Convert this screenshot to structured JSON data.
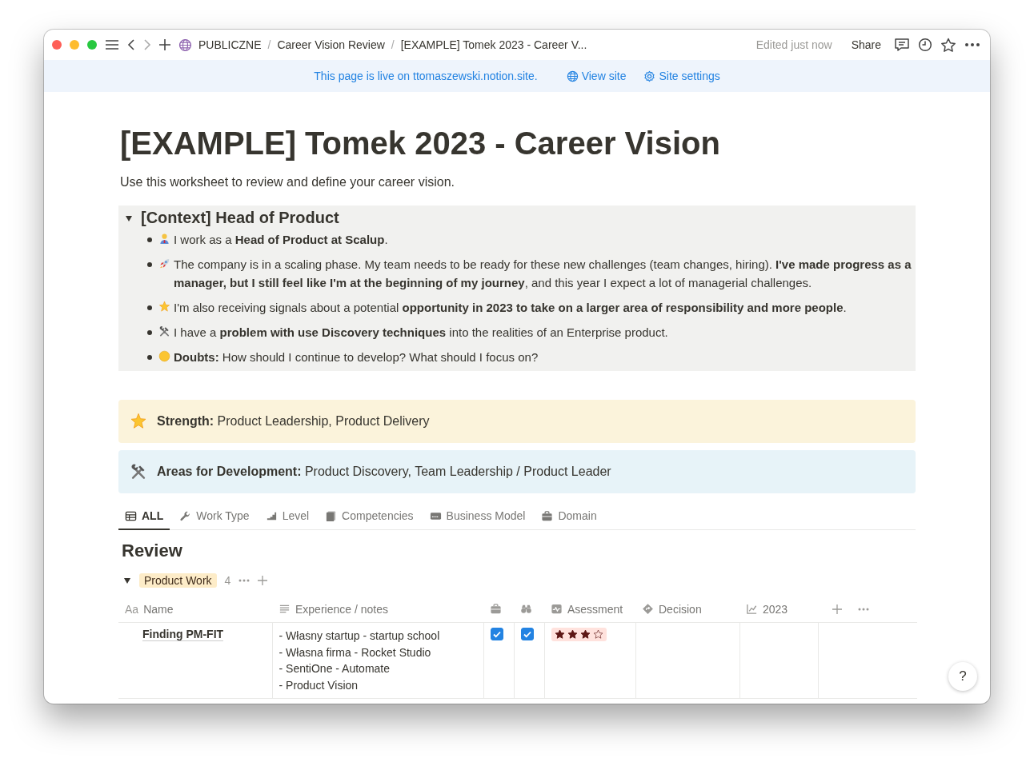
{
  "window": {
    "breadcrumbs": [
      "PUBLICZNE",
      "Career Vision Review",
      "[EXAMPLE] Tomek 2023 - Career V..."
    ],
    "breadcrumb_separator": "/",
    "edited": "Edited just now",
    "share": "Share"
  },
  "banner": {
    "text": "This page is live on ttomaszewski.notion.site.",
    "links": [
      {
        "kind": "globe",
        "label": "View site"
      },
      {
        "kind": "gear",
        "label": "Site settings"
      }
    ]
  },
  "page": {
    "title": "[EXAMPLE] Tomek 2023 - Career Vision",
    "description": "Use this worksheet to review and define your career vision.",
    "toggle": {
      "title": "[Context] Head of Product",
      "expanded": true,
      "items": [
        {
          "kind": "person",
          "text": "I work as a **Head of Product at Scalup**."
        },
        {
          "kind": "rocket",
          "text": "The company is in a scaling phase. My team needs to be ready for these new challenges (team changes, hiring). **I've made progress as a manager, but I still feel like I'm at the beginning of my journey**, and this year I expect a lot of managerial challenges."
        },
        {
          "kind": "sparkle",
          "text": "I'm also receiving signals about a potential **opportunity in 2023 to take on a larger area of responsibility and more people**."
        },
        {
          "kind": "tools",
          "text": "I have a **problem with use Discovery techniques** into the realities of an Enterprise product."
        },
        {
          "kind": "emoji",
          "text": "**Doubts:** How should I continue to develop? What should I focus on?"
        }
      ]
    },
    "callouts": [
      {
        "kind": "sparkle",
        "color": "#fbf3db",
        "text": "**Strength:** Product Leadership, Product Delivery"
      },
      {
        "kind": "tools",
        "color": "#e7f3f8",
        "text": "**Areas for Development:** Product Discovery, Team Leadership / Product Leader"
      }
    ],
    "tabs": [
      {
        "kind": "table",
        "label": "ALL",
        "selected": true
      },
      {
        "kind": "wrench",
        "label": "Work Type",
        "selected": false
      },
      {
        "kind": "bars",
        "label": "Level",
        "selected": false
      },
      {
        "kind": "pages",
        "label": "Competencies",
        "selected": false
      },
      {
        "kind": "card",
        "label": "Business Model",
        "selected": false
      },
      {
        "kind": "briefcase",
        "label": "Domain",
        "selected": false
      }
    ],
    "section_title": "Review",
    "group": {
      "label": "Product Work",
      "count": "4",
      "expanded": true
    },
    "table": {
      "columns": [
        {
          "prefix": "Aa",
          "label": "Name"
        },
        {
          "kind": "lines",
          "label": "Experience / notes"
        },
        {
          "kind": "briefcase"
        },
        {
          "kind": "binoculars"
        },
        {
          "kind": "pulse",
          "label": "Asessment"
        },
        {
          "kind": "diamond",
          "label": "Decision"
        },
        {
          "kind": "chart",
          "label": "2023"
        }
      ],
      "rows": [
        {
          "name": "Finding PM-FIT",
          "notes": [
            "- Własny startup - startup school",
            "- Własna firma - Rocket Studio",
            "- SentiOne - Automate",
            "- Product Vision"
          ],
          "checks": [
            true,
            true
          ],
          "stars": 3
        }
      ]
    }
  },
  "help": "?"
}
